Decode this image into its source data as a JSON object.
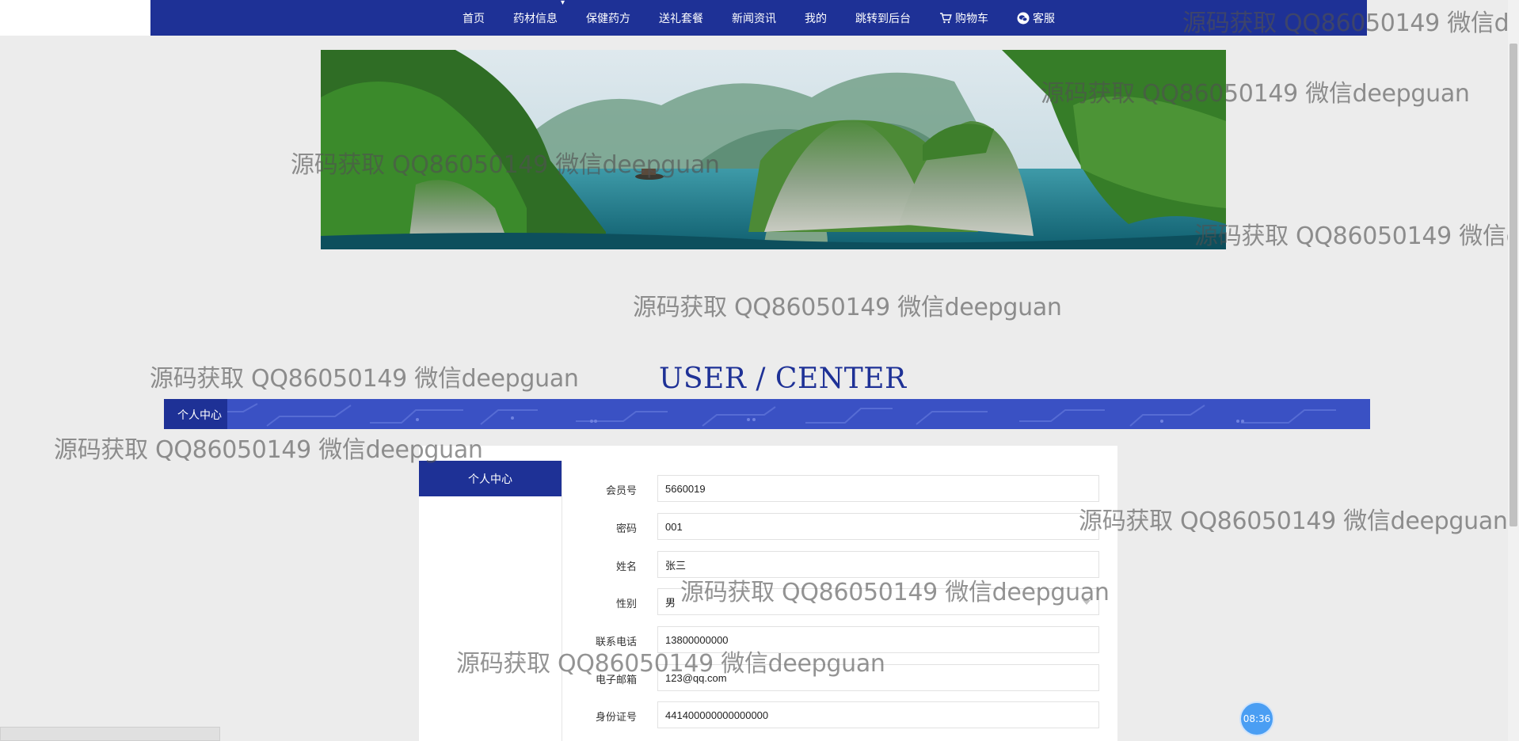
{
  "nav": {
    "items": [
      {
        "label": "首页",
        "icon": ""
      },
      {
        "label": "药材信息",
        "icon": ""
      },
      {
        "label": "保健药方",
        "icon": ""
      },
      {
        "label": "送礼套餐",
        "icon": ""
      },
      {
        "label": "新闻资讯",
        "icon": ""
      },
      {
        "label": "我的",
        "icon": ""
      },
      {
        "label": "跳转到后台",
        "icon": ""
      },
      {
        "label": "购物车",
        "icon": "cart-icon"
      },
      {
        "label": "客服",
        "icon": "chat-icon"
      }
    ]
  },
  "section": {
    "title": "USER / CENTER",
    "strip_label": "个人中心"
  },
  "sidebar": {
    "active_label": "个人中心"
  },
  "form": {
    "fields": [
      {
        "label": "会员号",
        "value": "5660019",
        "type": "text"
      },
      {
        "label": "密码",
        "value": "001",
        "type": "text"
      },
      {
        "label": "姓名",
        "value": "张三",
        "type": "text"
      },
      {
        "label": "性别",
        "value": "男",
        "type": "select"
      },
      {
        "label": "联系电话",
        "value": "13800000000",
        "type": "text"
      },
      {
        "label": "电子邮箱",
        "value": "123@qq.com",
        "type": "text"
      },
      {
        "label": "身份证号",
        "value": "441400000000000000",
        "type": "text"
      }
    ]
  },
  "watermark_text": "源码获取 QQ86050149 微信deepguan",
  "clock": "08:36",
  "colors": {
    "primary": "#1e3196",
    "strip": "#3a51c4",
    "page_bg": "#ececec"
  }
}
